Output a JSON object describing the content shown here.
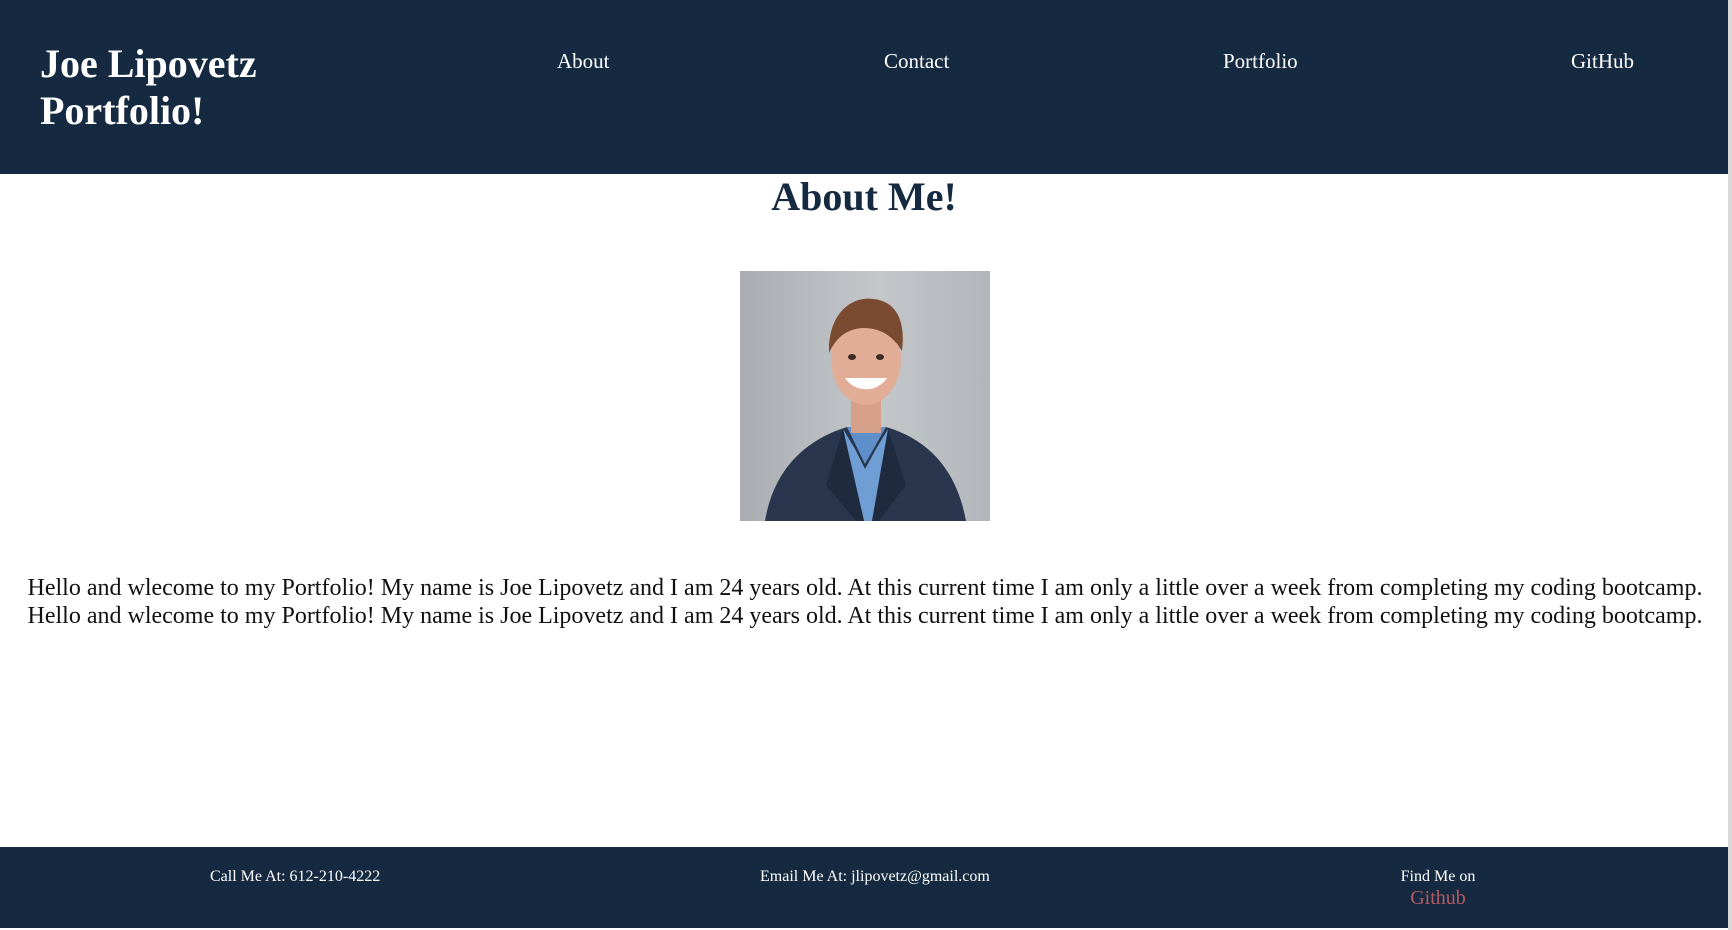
{
  "header": {
    "brand_line1": "Joe Lipovetz",
    "brand_line2": "Portfolio!",
    "nav": {
      "about": "About",
      "contact": "Contact",
      "portfolio": "Portfolio",
      "github": "GitHub"
    }
  },
  "main": {
    "title": "About Me!",
    "photo_alt": "Joe Lipovetz headshot",
    "bio": "Hello and wlecome to my Portfolio! My name is Joe Lipovetz and I am 24 years old. At this current time I am only a little over a week from completing my coding bootcamp. Hello and wlecome to my Portfolio! My name is Joe Lipovetz and I am 24 years old. At this current time I am only a little over a week from completing my coding bootcamp."
  },
  "footer": {
    "call": "Call Me At: 612-210-4222",
    "email": "Email Me At: jlipovetz@gmail.com",
    "find_label": "Find Me on",
    "github_link": "Github"
  },
  "colors": {
    "navy": "#152a41",
    "white": "#ffffff",
    "link_red": "#b55a62"
  }
}
